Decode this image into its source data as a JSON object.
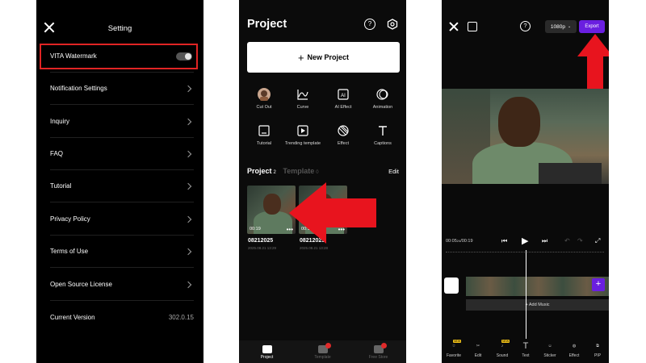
{
  "settings_screen": {
    "title": "Setting",
    "items": [
      {
        "label": "VITA Watermark"
      },
      {
        "label": "Notification Settings"
      },
      {
        "label": "Inquiry"
      },
      {
        "label": "FAQ"
      },
      {
        "label": "Tutorial"
      },
      {
        "label": "Privacy Policy"
      },
      {
        "label": "Terms of Use"
      },
      {
        "label": "Open Source License"
      },
      {
        "label": "Current Version"
      }
    ],
    "version_value": "302.0.15",
    "watermark_enabled": false
  },
  "project_screen": {
    "title": "Project",
    "new_project_label": "New Project",
    "tools": [
      {
        "label": "Cut Out",
        "icon": "cutout-avatar-icon"
      },
      {
        "label": "Curve",
        "icon": "curve-icon"
      },
      {
        "label": "AI Effect",
        "icon": "ai-effect-icon"
      },
      {
        "label": "Animation",
        "icon": "animation-icon"
      },
      {
        "label": "Tutorial",
        "icon": "tutorial-icon"
      },
      {
        "label": "Trending template",
        "icon": "trending-template-icon"
      },
      {
        "label": "Effect",
        "icon": "effect-icon"
      },
      {
        "label": "Captions",
        "icon": "captions-icon"
      }
    ],
    "section": {
      "project_tab": "Project",
      "project_count": "2",
      "template_tab": "Template",
      "template_count": "0",
      "edit_label": "Edit"
    },
    "projects": [
      {
        "duration": "00:19",
        "name": "08212025",
        "date": "2025.08.21 13:29"
      },
      {
        "duration": "00:15",
        "name": "08212025",
        "date": "2025.08.21 13:28"
      }
    ],
    "nav": [
      {
        "label": "Project"
      },
      {
        "label": "Template"
      },
      {
        "label": "Free Store"
      }
    ]
  },
  "editor_screen": {
    "resolution": "1080p",
    "export_label": "Export",
    "time_current": "00:05",
    "time_current_frame": "24",
    "time_total": "00:19",
    "add_music_label": "+ Add Music",
    "tools": [
      {
        "label": "Favorite",
        "icon": "favorite-star-icon",
        "badge": "NEW"
      },
      {
        "label": "Edit",
        "icon": "scissors-icon"
      },
      {
        "label": "Sound",
        "icon": "sound-note-icon",
        "badge": "NEW"
      },
      {
        "label": "Text",
        "icon": "text-icon"
      },
      {
        "label": "Sticker",
        "icon": "sticker-icon"
      },
      {
        "label": "Effect",
        "icon": "effect-icon"
      },
      {
        "label": "PIP",
        "icon": "pip-icon"
      }
    ]
  },
  "colors": {
    "highlight_red": "#e02424",
    "arrow_red": "#e8141e",
    "export_purple": "#6a1fe0"
  }
}
